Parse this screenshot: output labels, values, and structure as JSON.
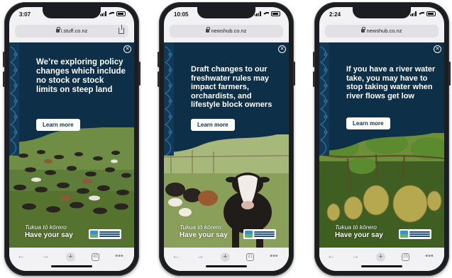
{
  "phones": [
    {
      "id": "stuff",
      "status_time": "3:07",
      "url": "i.stuff.co.nz",
      "headline": "We’re exploring policy changes which include no stock or stock limits on steep land",
      "cta": "Learn more",
      "footer_tagline": "Tukua tō kōrero",
      "footer_cta": "Have your say",
      "tab_count": "40"
    },
    {
      "id": "newshub-1",
      "status_time": "10:05",
      "url": "newshub.co.nz",
      "headline": "Draft changes to our freshwater rules may impact farmers, orchardists, and lifestyle block owners",
      "cta": "Learn more",
      "footer_tagline": "Tukua tō kōrero",
      "footer_cta": "Have your say",
      "tab_count": "21"
    },
    {
      "id": "newshub-2",
      "status_time": "2:24",
      "url": "newshub.co.nz",
      "headline": "If you have a river water take, you may have to stop taking water when river flows get low",
      "cta": "Learn more",
      "footer_tagline": "Tukua tō kōrero",
      "footer_cta": "Have your say",
      "tab_count": "25"
    }
  ],
  "colors": {
    "ad_navy": "#0e2f48",
    "device_frame": "#1b1d20",
    "browser_chrome": "#f2f2f4"
  },
  "icons": {
    "close": "close-icon",
    "back": "back-arrow-icon",
    "forward": "forward-arrow-icon",
    "new_tab": "plus-icon",
    "tabs": "tabs-icon",
    "more": "more-icon",
    "share": "share-icon",
    "lock": "lock-icon"
  }
}
